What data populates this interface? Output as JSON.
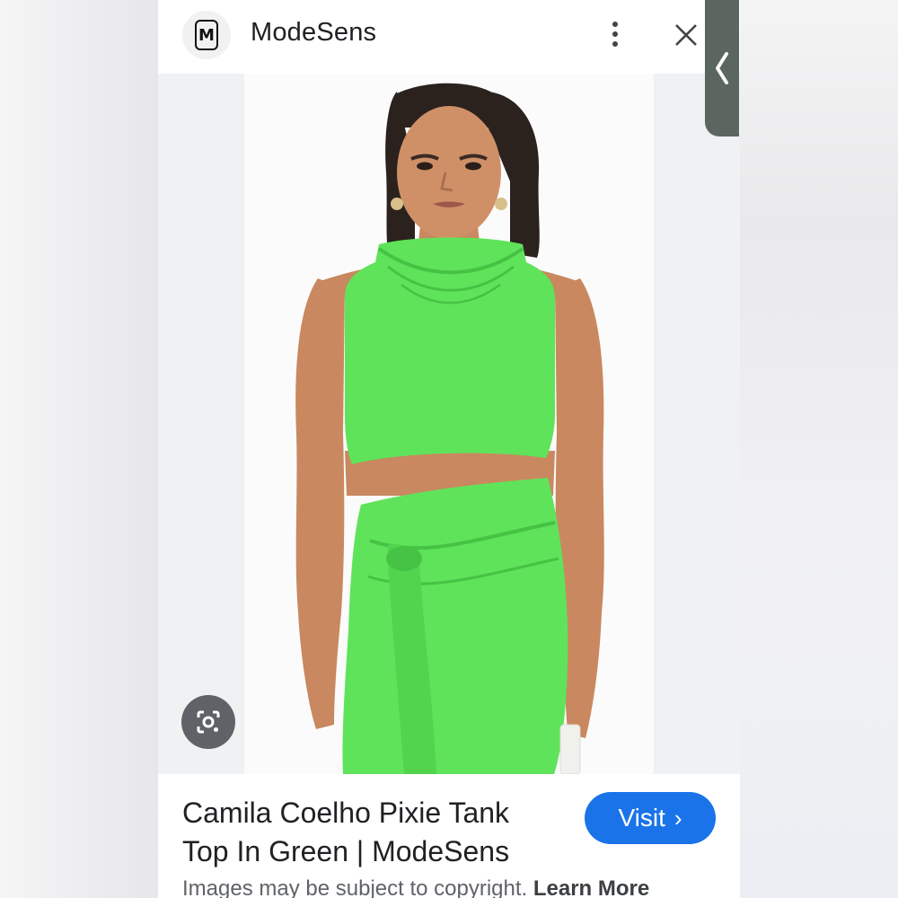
{
  "header": {
    "logo_letter": "M",
    "site_name": "ModeSens",
    "menu_icon": "more-vert-icon",
    "close_icon": "close-icon"
  },
  "image": {
    "subject": "model wearing green cowl-neck crop tank and green tie-front skirt",
    "lens_icon": "google-lens-icon"
  },
  "result": {
    "title": "Camila Coelho Pixie Tank Top In Green | ModeSens",
    "visit_label": "Visit",
    "copyright_text": "Images may be subject to copyright.",
    "learn_more_label": "Learn More"
  },
  "side_handle": {
    "icon": "chevron-left-icon"
  },
  "colors": {
    "visit_button": "#1a73e8",
    "garment_green": "#5fe35a",
    "lens_button": "#5f6368",
    "side_handle": "#5b6660"
  }
}
